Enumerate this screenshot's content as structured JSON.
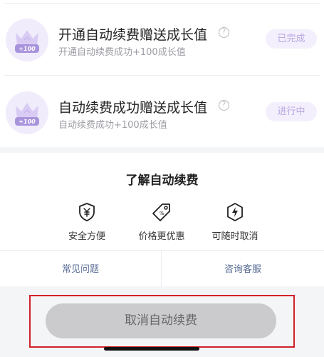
{
  "tasks": [
    {
      "title": "开通自动续费赠送成长值",
      "desc": "开通自动续费成功+100成长值",
      "status": "已完成",
      "bonus": "+100"
    },
    {
      "title": "自动续费成功赠送成长值",
      "desc": "自动续费成功+100成长值",
      "status": "进行中",
      "bonus": "+100"
    }
  ],
  "info": {
    "title": "了解自动续费",
    "features": [
      {
        "label": "安全方便",
        "icon": "shield-yuan-icon"
      },
      {
        "label": "价格更优惠",
        "icon": "price-tag-icon"
      },
      {
        "label": "可随时取消",
        "icon": "lightning-hexagon-icon"
      }
    ],
    "links": [
      "常见问题",
      "咨询客服"
    ]
  },
  "cancel": {
    "label": "取消自动续费"
  },
  "colors": {
    "accent_purple": "#b9a8e3",
    "link_blue": "#5a6e96",
    "highlight_red": "#d3212a",
    "button_gray": "#cbcbcd"
  }
}
